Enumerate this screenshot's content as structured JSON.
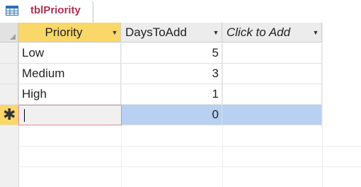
{
  "tab": {
    "title": "tblPriority",
    "icon": "table-icon"
  },
  "headers": [
    {
      "label": "Priority",
      "icon": "dropdown-arrow-icon"
    },
    {
      "label": "DaysToAdd",
      "icon": "dropdown-arrow-icon"
    },
    {
      "label": "Click to Add",
      "icon": "dropdown-arrow-icon"
    }
  ],
  "rows": [
    {
      "priority": "Low",
      "days": "5"
    },
    {
      "priority": "Medium",
      "days": "3"
    },
    {
      "priority": "High",
      "days": "1"
    }
  ],
  "new_row": {
    "marker": "✱",
    "priority": "",
    "days": "0"
  },
  "colors": {
    "tab_text": "#b03050",
    "active_header": "#f9d769",
    "selection": "#b8d1f3"
  }
}
